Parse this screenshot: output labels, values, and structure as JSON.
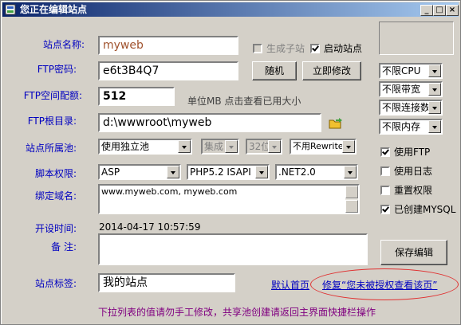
{
  "window": {
    "title": "您正在编辑站点"
  },
  "labels": {
    "site_name": "站点名称:",
    "ftp_password": "FTP密码:",
    "ftp_quota": "FTP空间配额:",
    "ftp_root": "FTP根目录:",
    "app_pool": "站点所属池:",
    "script": "脚本权限:",
    "bind_domain": "绑定域名:",
    "created": "开设时间:",
    "remark": "备 注:",
    "tag": "站点标签:"
  },
  "fields": {
    "site_name": "myweb",
    "ftp_password": "e6t3B4Q7",
    "ftp_quota": "512",
    "ftp_quota_hint": "单位MB 点击查看已用大小",
    "ftp_root": "d:\\wwwroot\\myweb",
    "domains": "www.myweb.com, myweb.com",
    "created_time": "2014-04-17 10:57:59",
    "remark": "",
    "tag": "我的站点"
  },
  "buttons": {
    "random": "随机",
    "modify_now": "立即修改",
    "save": "保存编辑"
  },
  "checkboxes": {
    "generate_subsite": {
      "label": "生成子站",
      "checked": false,
      "disabled": true
    },
    "enable_site": {
      "label": "启动站点",
      "checked": true
    },
    "use_ftp": {
      "label": "使用FTP",
      "checked": true
    },
    "use_log": {
      "label": "使用日志",
      "checked": false
    },
    "reset_perm": {
      "label": "重置权限",
      "checked": false
    },
    "mysql_created": {
      "label": "已创建MYSQL",
      "checked": true
    }
  },
  "selects": {
    "pool": "使用独立池",
    "integration": "集成",
    "bits": "32位",
    "rewrite": "不用Rewrite",
    "script": "ASP",
    "php": "PHP5.2 ISAPI",
    "net": ".NET2.0",
    "cpu": "不限CPU",
    "bandwidth": "不限带宽",
    "connections": "不限连接数",
    "memory": "不限内存"
  },
  "links": {
    "default_page": "默认首页",
    "fix": "修复“您未被授权查看该页”"
  },
  "footer_note": "下拉列表的值请勿手工修改，共享池创建请返回主界面快捷栏操作",
  "colors": {
    "title_start": "#0a246a",
    "title_end": "#a6caf0",
    "label": "#0000c0",
    "note": "#800080",
    "highlight_ring": "#e03030",
    "site_name_text": "#a0522d"
  }
}
